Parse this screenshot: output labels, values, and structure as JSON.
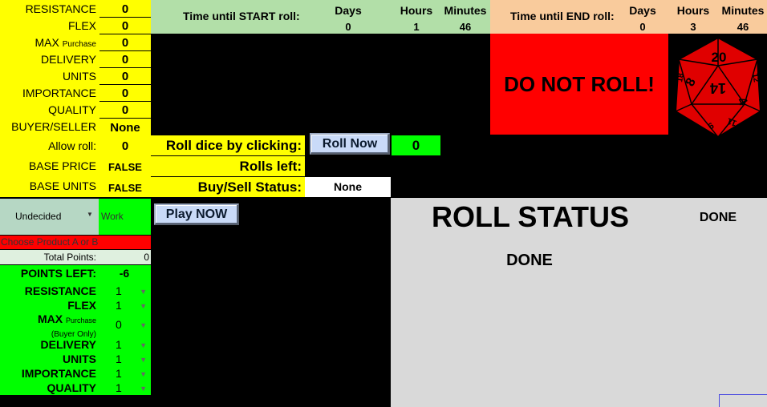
{
  "attrs": [
    {
      "label": "RESISTANCE",
      "value": "0"
    },
    {
      "label": "FLEX",
      "value": "0"
    },
    {
      "label": "MAX",
      "sub": "Purchase",
      "value": "0"
    },
    {
      "label": "DELIVERY",
      "value": "0"
    },
    {
      "label": "UNITS",
      "value": "0"
    },
    {
      "label": "IMPORTANCE",
      "value": "0"
    },
    {
      "label": "QUALITY",
      "value": "0"
    },
    {
      "label": "BUYER/SELLER",
      "value": "None"
    },
    {
      "label": "Allow roll:",
      "value": "0"
    },
    {
      "label": "BASE PRICE",
      "value": "FALSE"
    },
    {
      "label": "BASE UNITS",
      "value": "FALSE"
    }
  ],
  "start": {
    "title": "Time until START roll:",
    "days_label": "Days",
    "hours_label": "Hours",
    "minutes_label": "Minutes",
    "days": "0",
    "hours": "1",
    "minutes": "46"
  },
  "end": {
    "title": "Time until END roll:",
    "days_label": "Days",
    "hours_label": "Hours",
    "minutes_label": "Minutes",
    "days": "0",
    "hours": "3",
    "minutes": "46"
  },
  "warning": "DO NOT ROLL!",
  "d20": {
    "top": "20",
    "left": "8",
    "center": "14",
    "right": "4",
    "bottom": "6",
    "br": "11",
    "tl": "18",
    "tr": "12"
  },
  "roll": {
    "label": "Roll dice by clicking:",
    "button": "Roll Now",
    "value": "0",
    "rolls_left_label": "Rolls left:",
    "rolls_left": "",
    "buysell_label": "Buy/Sell Status:",
    "buysell": "None"
  },
  "selector": {
    "selected": "Undecided",
    "category": "Work",
    "choose": "Choose Product A or B",
    "total_label": "Total Points:",
    "total": "0",
    "play": "Play NOW"
  },
  "points": {
    "label": "POINTS LEFT:",
    "value": "-6",
    "rows": [
      {
        "label": "RESISTANCE",
        "value": "1"
      },
      {
        "label": "FLEX",
        "value": "1"
      },
      {
        "label": "MAX",
        "sub": "Purchase",
        "sub2": "(Buyer Only)",
        "value": "0"
      },
      {
        "label": "DELIVERY",
        "value": "1"
      },
      {
        "label": "UNITS",
        "value": "1"
      },
      {
        "label": "IMPORTANCE",
        "value": "1"
      },
      {
        "label": "QUALITY",
        "value": "1"
      }
    ]
  },
  "status": {
    "title": "ROLL STATUS",
    "state": "DONE",
    "sub": "DONE"
  }
}
